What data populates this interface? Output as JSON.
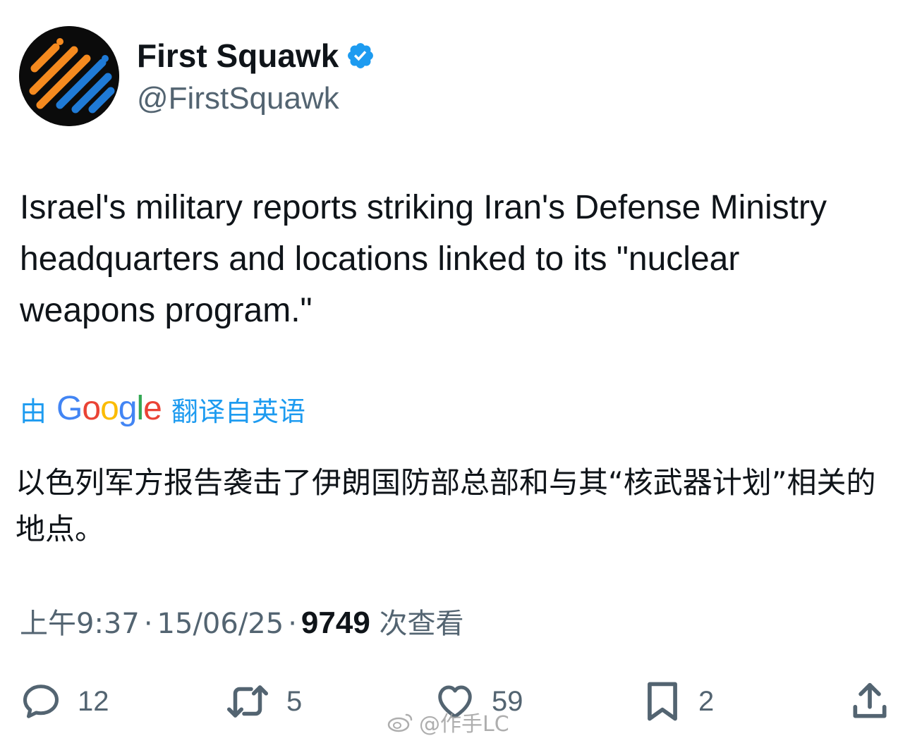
{
  "author": {
    "display_name": "First Squawk",
    "handle": "@FirstSquawk",
    "verified": true,
    "avatar_icon": "first-squawk-logo"
  },
  "tweet": {
    "text": "Israel's military reports striking Iran's Defense Ministry headquarters and locations linked to its \"nuclear weapons program.\""
  },
  "translation": {
    "prefix": "由",
    "provider": "Google",
    "suffix": "翻译自英语",
    "text": "以色列军方报告袭击了伊朗国防部总部和与其“核武器计划”相关的地点。"
  },
  "meta": {
    "time": "上午9:37",
    "date": "15/06/25",
    "views_count": "9749",
    "views_label": "次查看",
    "separator": "·"
  },
  "actions": {
    "reply_count": "12",
    "retweet_count": "5",
    "like_count": "59",
    "bookmark_count": "2"
  },
  "watermark": {
    "text": "@作手LC"
  },
  "colors": {
    "link_blue": "#1d9bf0",
    "secondary_text": "#536471",
    "primary_text": "#0f1419",
    "avatar_orange": "#f58a1f",
    "avatar_blue": "#1f7ad6"
  }
}
